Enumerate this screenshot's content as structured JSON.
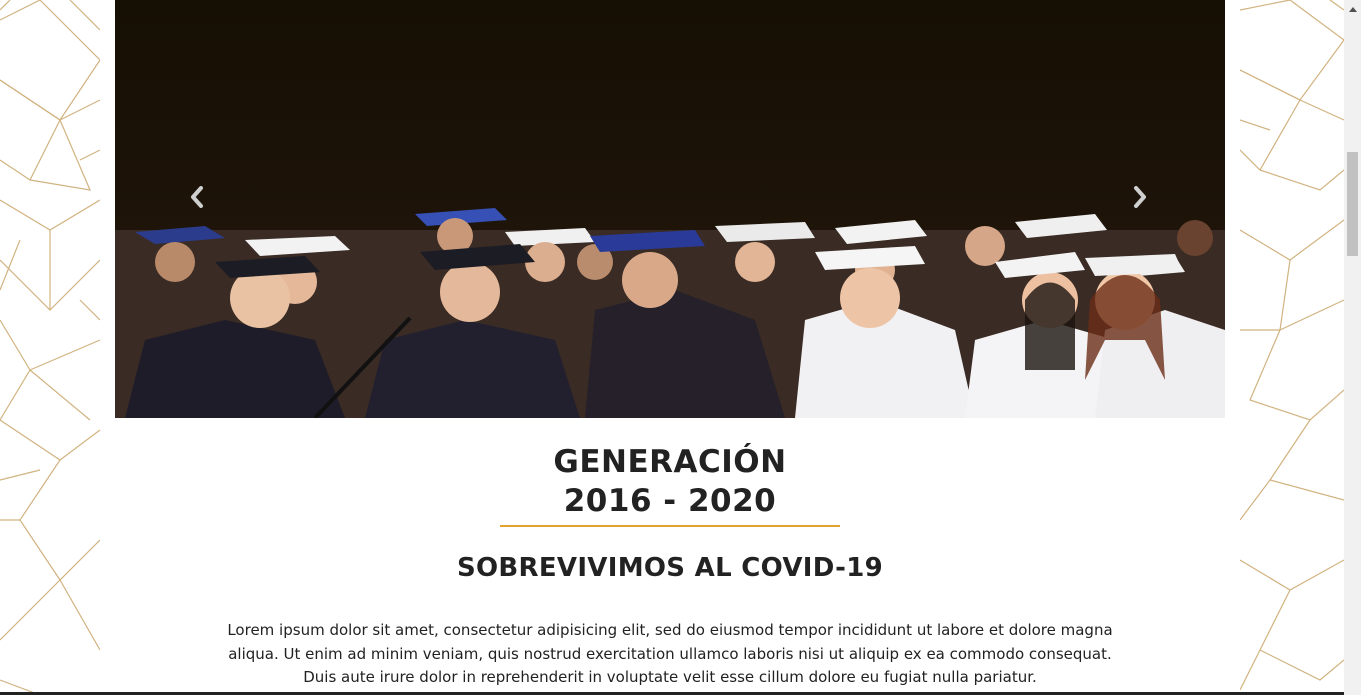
{
  "hero": {
    "image_description": "graduates-in-caps-and-gowns",
    "prev_label": "Previous",
    "next_label": "Next"
  },
  "heading": {
    "line1": "GENERACIÓN",
    "line2": "2016 - 2020"
  },
  "subtitle": "SOBREVIVIMOS AL COVID-19",
  "paragraph": "Lorem ipsum dolor sit amet, consectetur adipisicing elit, sed do eiusmod tempor incididunt ut labore et dolore magna aliqua. Ut enim ad minim veniam, quis nostrud exercitation ullamco laboris nisi ut aliquip ex ea commodo consequat. Duis aute irure dolor in reprehenderit in voluptate velit esse cillum dolore eu fugiat nulla pariatur.",
  "colors": {
    "accent_gold": "#e3a12e",
    "text": "#222222",
    "pattern_gold": "#c9a66b"
  },
  "icons": {
    "prev": "chevron-left-icon",
    "next": "chevron-right-icon",
    "scroll_up": "caret-up-icon"
  }
}
